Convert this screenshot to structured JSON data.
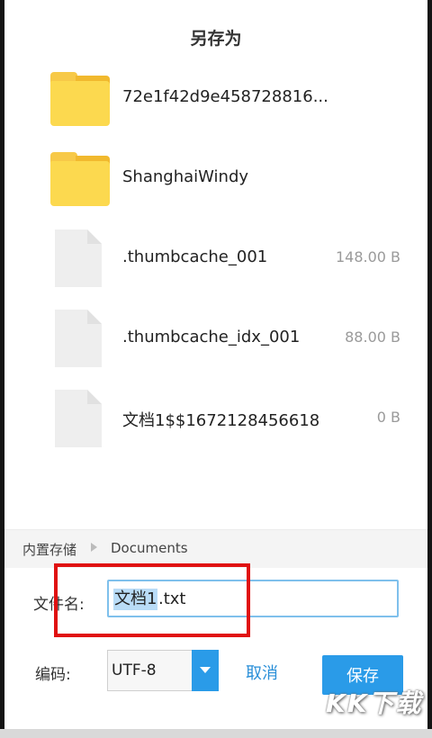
{
  "dialog": {
    "title": "另存为"
  },
  "files": [
    {
      "name": "72e1f42d9e458728816...",
      "size": "",
      "type": "folder"
    },
    {
      "name": "ShanghaiWindy",
      "size": "",
      "type": "folder"
    },
    {
      "name": ".thumbcache_001",
      "size": "148.00 B",
      "type": "file"
    },
    {
      "name": ".thumbcache_idx_001",
      "size": "88.00 B",
      "type": "file"
    },
    {
      "name": "文档1$$1672128456618",
      "size": "0 B",
      "type": "file"
    }
  ],
  "breadcrumb": {
    "root": "内置存储",
    "current": "Documents"
  },
  "filename": {
    "label": "文件名:",
    "selected_part": "文档1",
    "extension": ".txt"
  },
  "encoding": {
    "label": "编码:",
    "value": "UTF-8"
  },
  "actions": {
    "cancel": "取消",
    "save": "保存"
  },
  "watermark": {
    "text": "KK下载"
  },
  "colors": {
    "accent": "#2a9be8",
    "folder": "#fcd94f",
    "highlight": "#e01010"
  }
}
